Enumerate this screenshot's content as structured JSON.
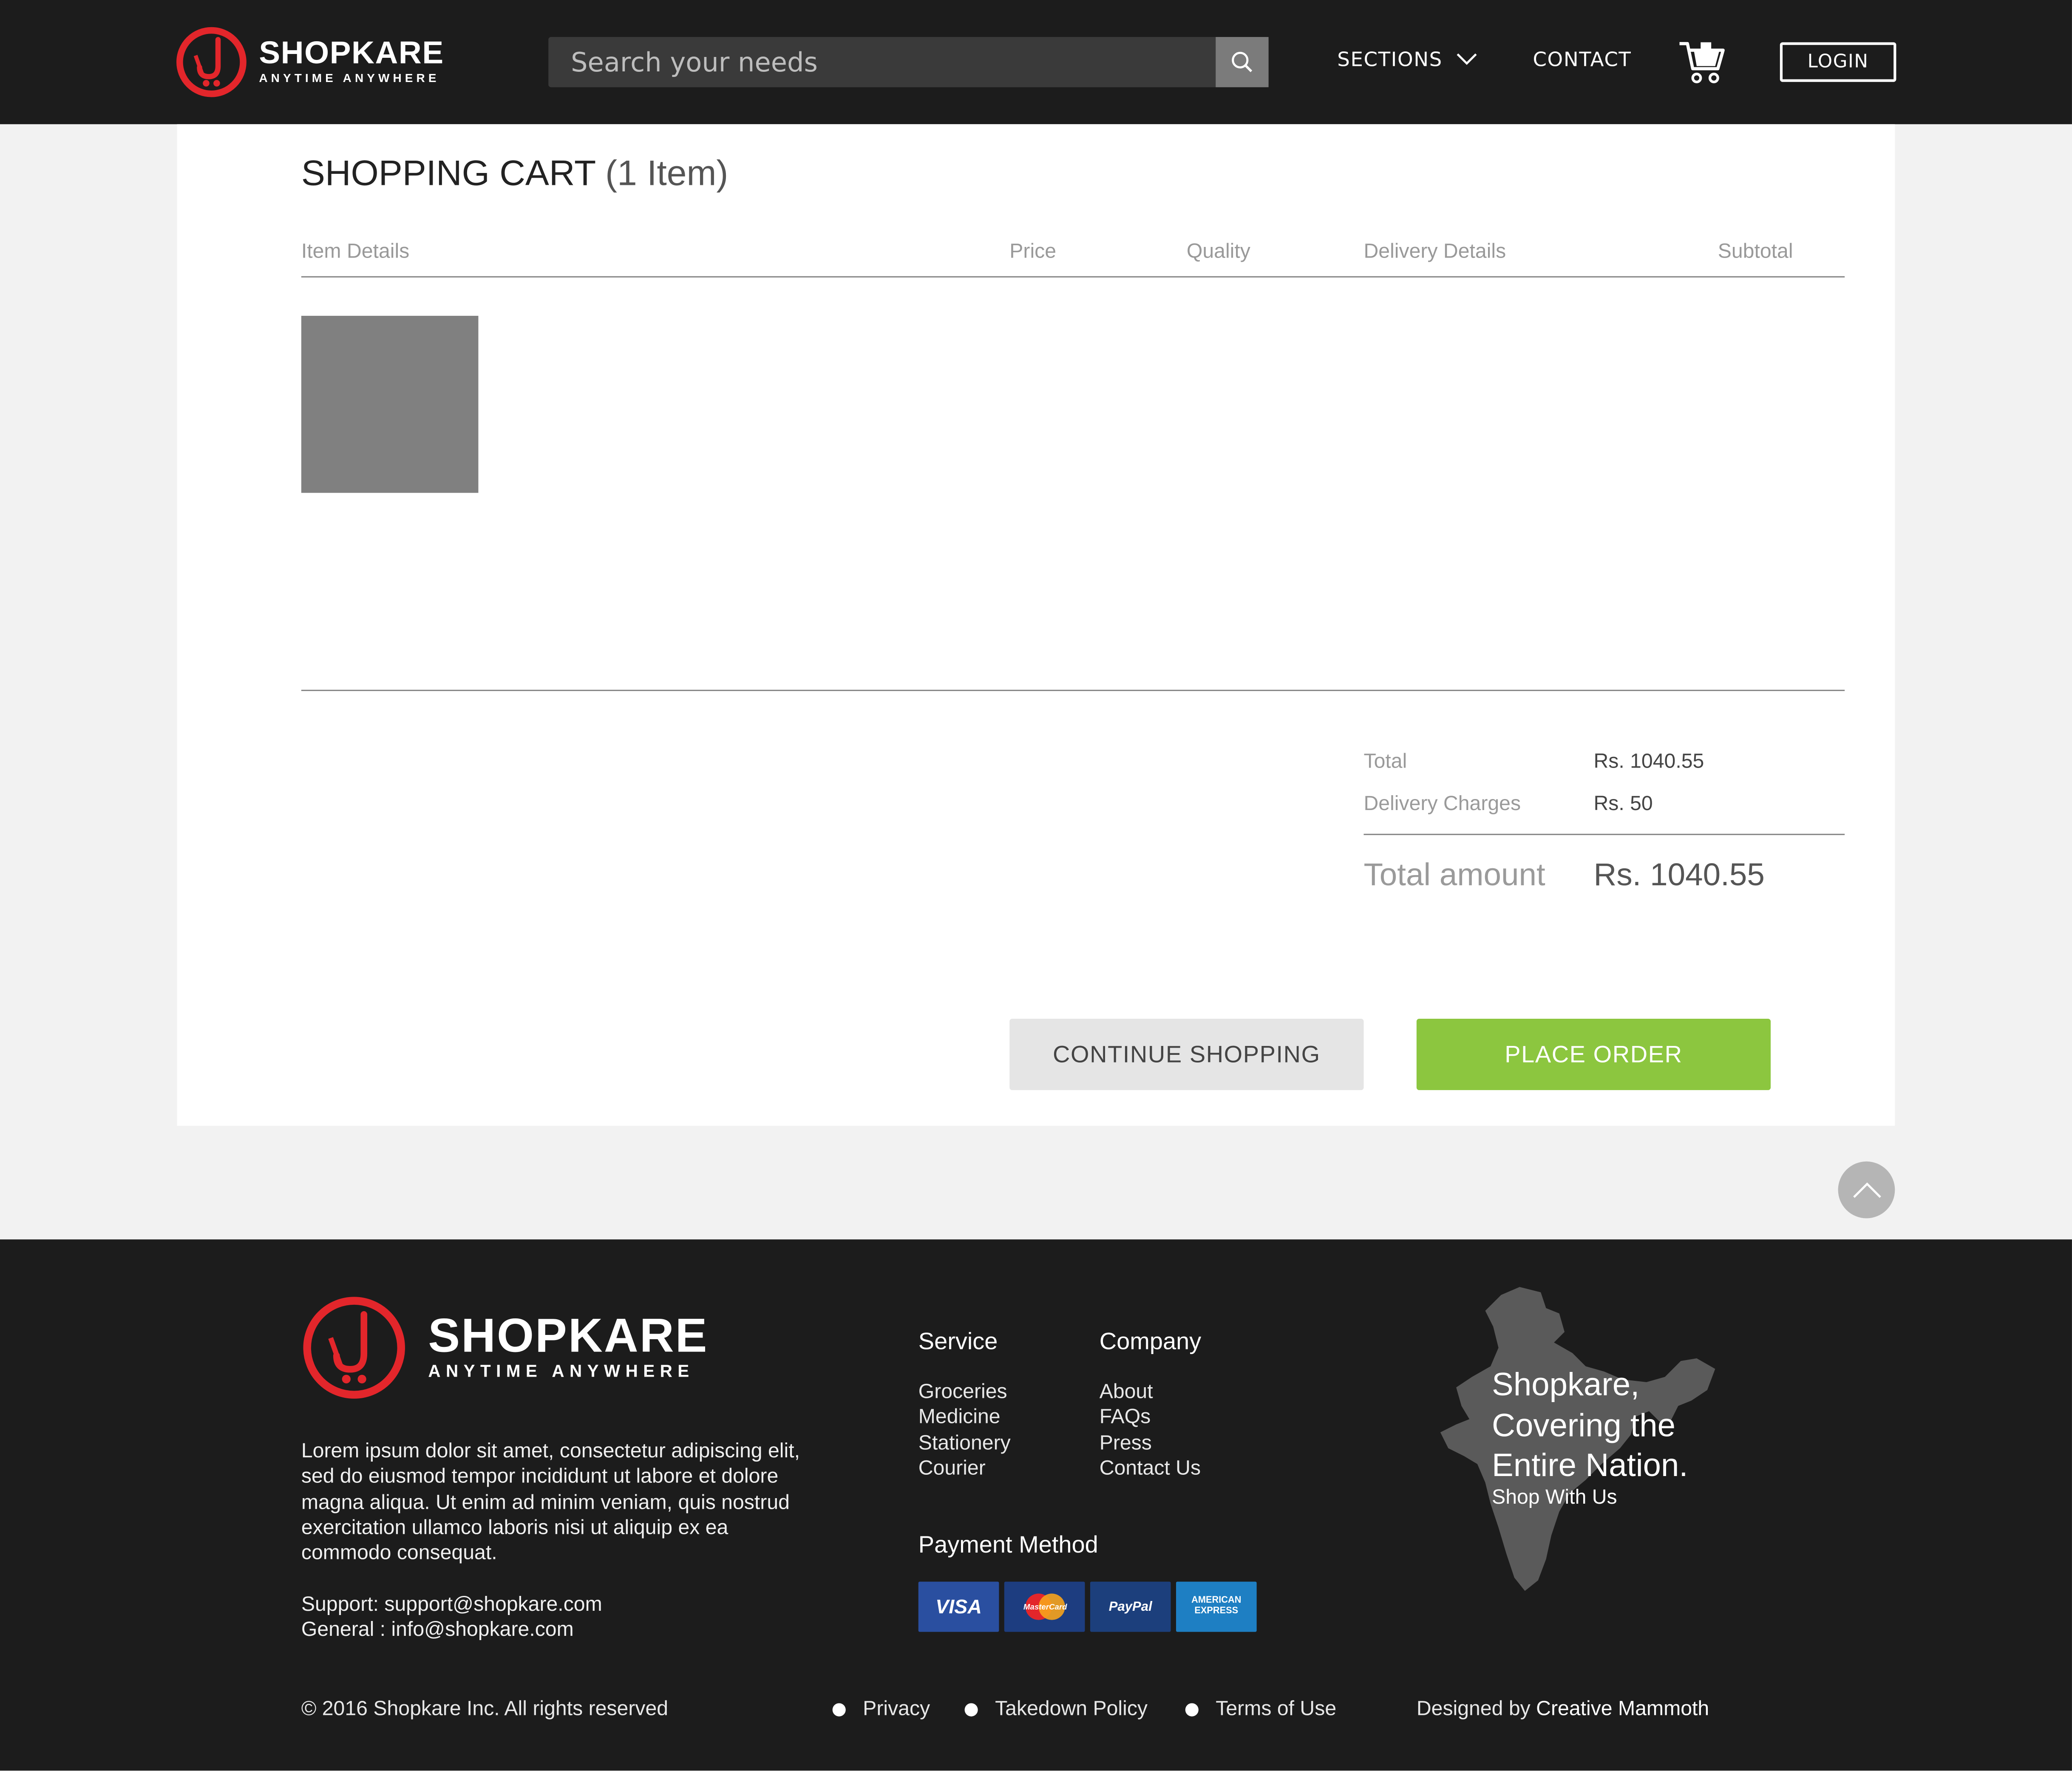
{
  "header": {
    "brand": "SHOPKARE",
    "tagline": "ANYTIME ANYWHERE",
    "search_placeholder": "Search your needs",
    "nav_sections": "SECTIONS",
    "nav_contact": "CONTACT",
    "login": "LOGIN"
  },
  "cart": {
    "title": "SHOPPING CART",
    "count": "(1 Item)",
    "columns": [
      "Item Details",
      "Price",
      "Quality",
      "Delivery Details",
      "Subtotal"
    ],
    "summary": {
      "total_label": "Total",
      "total_value": "Rs. 1040.55",
      "delivery_label": "Delivery Charges",
      "delivery_value": "Rs. 50",
      "amount_label": "Total amount",
      "amount_value": "Rs. 1040.55"
    },
    "continue_label": "CONTINUE SHOPPING",
    "order_label": "PLACE ORDER"
  },
  "footer": {
    "brand": "SHOPKARE",
    "tagline": "ANYTIME ANYWHERE",
    "about": "Lorem ipsum dolor sit amet, consectetur adipiscing elit, sed do eiusmod tempor incididunt ut labore et dolore magna aliqua. Ut enim ad minim veniam, quis nostrud exercitation ullamco laboris nisi ut aliquip ex ea commodo consequat.",
    "support": "Support: support@shopkare.com",
    "general": "General : info@shopkare.com",
    "service_head": "Service",
    "service": [
      "Groceries",
      "Medicine",
      "Stationery",
      "Courier"
    ],
    "company_head": "Company",
    "company": [
      "About",
      "FAQs",
      "Press",
      "Contact Us"
    ],
    "payment_head": "Payment Method",
    "payment_cards": [
      "VISA",
      "MasterCard",
      "PayPal",
      "AMERICAN EXPRESS"
    ],
    "map_lines": [
      "Shopkare,",
      "Covering the",
      "Entire Nation."
    ],
    "map_sub": "Shop With Us",
    "copyright": "© 2016 Shopkare Inc. All rights reserved",
    "links": [
      "Privacy",
      "Takedown Policy",
      "Terms of Use"
    ],
    "credit_prefix": "Designed by",
    "credit_name": "Creative Mammoth"
  },
  "colors": {
    "header_bg": "#1c1c1c",
    "brand_red": "#e3262b",
    "order_green": "#8cc63f"
  },
  "icons": [
    "logo-mark",
    "search-icon",
    "chevron-down-icon",
    "cart-icon",
    "arrow-up-icon",
    "india-map"
  ]
}
